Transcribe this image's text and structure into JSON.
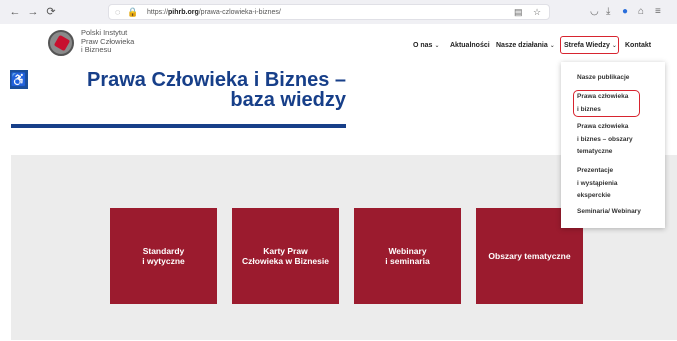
{
  "browser": {
    "back": "←",
    "forward": "→",
    "reload": "⟳",
    "url_prefix": "https://",
    "url_domain": "pihrb.org",
    "url_path": "/prawa-czlowieka-i-biznes/"
  },
  "logo": {
    "line1": "Polski Instytut",
    "line2": "Praw Człowieka",
    "line3": "i Biznesu"
  },
  "menu": {
    "o_nas": "O nas",
    "aktualnosci": "Aktualności",
    "nasze_dzialania": "Nasze działania",
    "strefa_wiedzy": "Strefa Wiedzy",
    "kontakt": "Kontakt",
    "chevron": "⌄"
  },
  "accessibility_icon": "♿",
  "hero": {
    "title_line1": "Prawa Człowieka i Biznes –",
    "title_line2": "baza wiedzy"
  },
  "tiles": [
    {
      "line1": "Standardy",
      "line2": "i wytyczne"
    },
    {
      "line1": "Karty Praw",
      "line2": "Człowieka w Biznesie"
    },
    {
      "line1": "Webinary",
      "line2": "i seminaria"
    },
    {
      "line1": "Obszary tematyczne",
      "line2": ""
    }
  ],
  "dropdown": {
    "items": [
      {
        "line1": "Nasze publikacje",
        "line2": "",
        "line3": ""
      },
      {
        "line1": "Prawa człowieka",
        "line2": "i biznes",
        "line3": ""
      },
      {
        "line1": "Prawa człowieka",
        "line2": "i biznes – obszary",
        "line3": "tematyczne"
      },
      {
        "line1": "Prezentacje",
        "line2": "i wystąpienia",
        "line3": "eksperckie"
      },
      {
        "line1": "Seminaria/ Webinary",
        "line2": "",
        "line3": ""
      }
    ]
  },
  "colors": {
    "brand_blue": "#173f89",
    "tile_red": "#9b1b2e",
    "highlight_red": "#d7242f"
  }
}
